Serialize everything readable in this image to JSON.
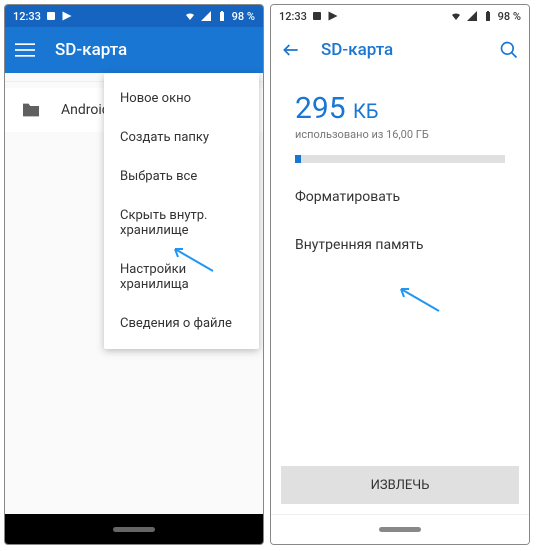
{
  "status": {
    "time": "12:33",
    "battery": "98 %"
  },
  "left": {
    "title": "SD-карта",
    "folder": "Android",
    "menu": [
      "Новое окно",
      "Создать папку",
      "Выбрать все",
      "Скрыть внутр. хранилище",
      "Настройки хранилища",
      "Сведения о файле"
    ]
  },
  "right": {
    "title": "SD-карта",
    "size_value": "295",
    "size_unit": "КБ",
    "used_text": "использовано из 16,00 ГБ",
    "options": [
      "Форматировать",
      "Внутренняя память"
    ],
    "eject": "ИЗВЛЕЧЬ"
  }
}
